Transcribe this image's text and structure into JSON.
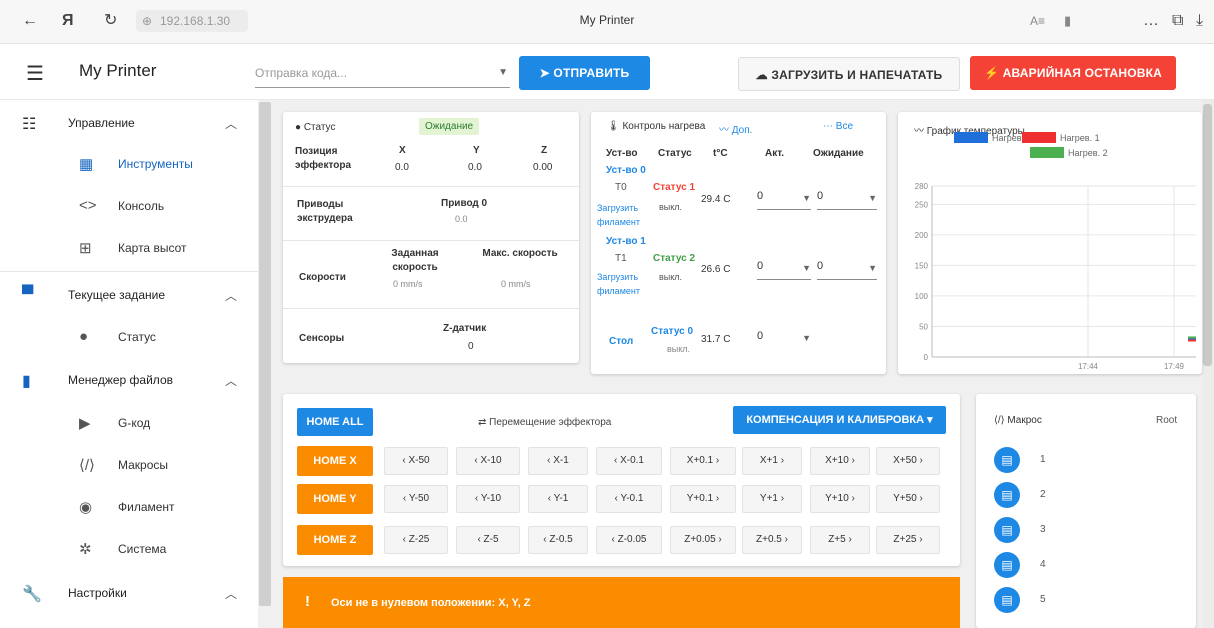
{
  "browser": {
    "url": "192.168.1.30",
    "title": "My Printer",
    "yandex_glyph": "Я",
    "icons": [
      "back-icon",
      "refresh-icon",
      "globe-icon",
      "reader-icon",
      "bookmark-icon",
      "more-icon",
      "collections-icon",
      "download-icon"
    ]
  },
  "appbar": {
    "title": "My Printer",
    "gcode_placeholder": "Отправка кода...",
    "send_label": "ОТПРАВИТЬ",
    "upload_label": "ЗАГРУЗИТЬ И НАПЕЧАТАТЬ",
    "estop_label": "АВАРИЙНАЯ ОСТАНОВКА",
    "accent": "#1e88e5",
    "danger": "#f44336"
  },
  "sidebar": {
    "groups": [
      {
        "label": "Управление",
        "icon": "tune-icon",
        "items": [
          {
            "label": "Инструменты",
            "icon": "dashboard-icon",
            "active": true
          },
          {
            "label": "Консоль",
            "icon": "code-icon"
          },
          {
            "label": "Карта высот",
            "icon": "grid-icon"
          }
        ]
      },
      {
        "label": "Текущее задание",
        "icon": "printer-icon",
        "items": [
          {
            "label": "Статус",
            "icon": "info-icon"
          }
        ]
      },
      {
        "label": "Менеджер файлов",
        "icon": "sd-card-icon",
        "items": [
          {
            "label": "G-код",
            "icon": "play-icon"
          },
          {
            "label": "Макросы",
            "icon": "code-braces-icon"
          },
          {
            "label": "Филамент",
            "icon": "radio-icon"
          },
          {
            "label": "Система",
            "icon": "cog-icon"
          }
        ]
      },
      {
        "label": "Настройки",
        "icon": "wrench-icon",
        "items": []
      }
    ]
  },
  "status": {
    "title": "Статус",
    "state": "Ожидание",
    "position_label": "Позиция эффектора",
    "axes": [
      {
        "name": "X",
        "value": "0.0"
      },
      {
        "name": "Y",
        "value": "0.0"
      },
      {
        "name": "Z",
        "value": "0.00"
      }
    ],
    "drives_label": "Приводы экструдера",
    "drive0_label": "Привод 0",
    "drive0_value": "0.0",
    "speeds_label": "Скорости",
    "req_speed_label": "Заданная скорость",
    "req_speed_value": "0 mm/s",
    "max_speed_label": "Макс. скорость",
    "max_speed_value": "0 mm/s",
    "sensors_label": "Сенсоры",
    "zprobe_label": "Z-датчик",
    "zprobe_value": "0",
    "state_color": "#e3f4d3"
  },
  "heaters": {
    "title": "Контроль нагрева",
    "extra_label": "Доп.",
    "all_label": "Все",
    "columns": [
      "Уст-во",
      "Статус",
      "t°C",
      "Акт.",
      "Ожидание"
    ],
    "tools": [
      {
        "name": "Уст-во 0",
        "num": "T0",
        "status": "Статус 1",
        "status_color": "#f44336",
        "load": "Загрузить филамент",
        "state": "выкл.",
        "temp": "29.4 C",
        "active": "0",
        "standby": "0"
      },
      {
        "name": "Уст-во 1",
        "num": "T1",
        "status": "Статус 2",
        "status_color": "#43a047",
        "load": "Загрузить филамент",
        "state": "выкл.",
        "temp": "26.6 C",
        "active": "0",
        "standby": "0"
      }
    ],
    "bed": {
      "name": "Стол",
      "status": "Статус 0",
      "sub": "выкл.",
      "temp": "31.7 C",
      "active": "0"
    }
  },
  "temp_chart": {
    "title": "График температуры",
    "legend": [
      {
        "name": "Нагрев. 0",
        "color": "#1e6fd9"
      },
      {
        "name": "Нагрев. 1",
        "color": "#f03030"
      },
      {
        "name": "Нагрев. 2",
        "color": "#4caf50"
      }
    ]
  },
  "chart_data": {
    "type": "line",
    "title": "График температуры",
    "series": [
      {
        "name": "Нагрев. 0",
        "color": "#1e6fd9",
        "x": [
          "17:49"
        ],
        "values": [
          29
        ]
      },
      {
        "name": "Нагрев. 1",
        "color": "#f03030",
        "x": [
          "17:49"
        ],
        "values": [
          27
        ]
      },
      {
        "name": "Нагрев. 2",
        "color": "#4caf50",
        "x": [
          "17:49"
        ],
        "values": [
          32
        ]
      }
    ],
    "yticks": [
      0,
      50,
      100,
      150,
      200,
      250,
      280
    ],
    "xticks": [
      "17:44",
      "17:49"
    ],
    "ylim": [
      0,
      280
    ],
    "grid": true,
    "legend": "top"
  },
  "movement": {
    "home_all": "HOME ALL",
    "title": "Перемещение эффектора",
    "comp_label": "КОМПЕНСАЦИЯ И КАЛИБРОВКА",
    "rows": [
      {
        "home": "HOME X",
        "buttons": [
          "X-50",
          "X-10",
          "X-1",
          "X-0.1",
          "X+0.1",
          "X+1",
          "X+10",
          "X+50"
        ]
      },
      {
        "home": "HOME Y",
        "buttons": [
          "Y-50",
          "Y-10",
          "Y-1",
          "Y-0.1",
          "Y+0.1",
          "Y+1",
          "Y+10",
          "Y+50"
        ]
      },
      {
        "home": "HOME Z",
        "buttons": [
          "Z-25",
          "Z-5",
          "Z-0.5",
          "Z-0.05",
          "Z+0.05",
          "Z+0.5",
          "Z+5",
          "Z+25"
        ]
      }
    ],
    "warning": "Оси не в нулевом положении: X, Y, Z"
  },
  "macros": {
    "title": "Макрос",
    "root": "Root",
    "items": [
      "1",
      "2",
      "3",
      "4",
      "5"
    ]
  }
}
